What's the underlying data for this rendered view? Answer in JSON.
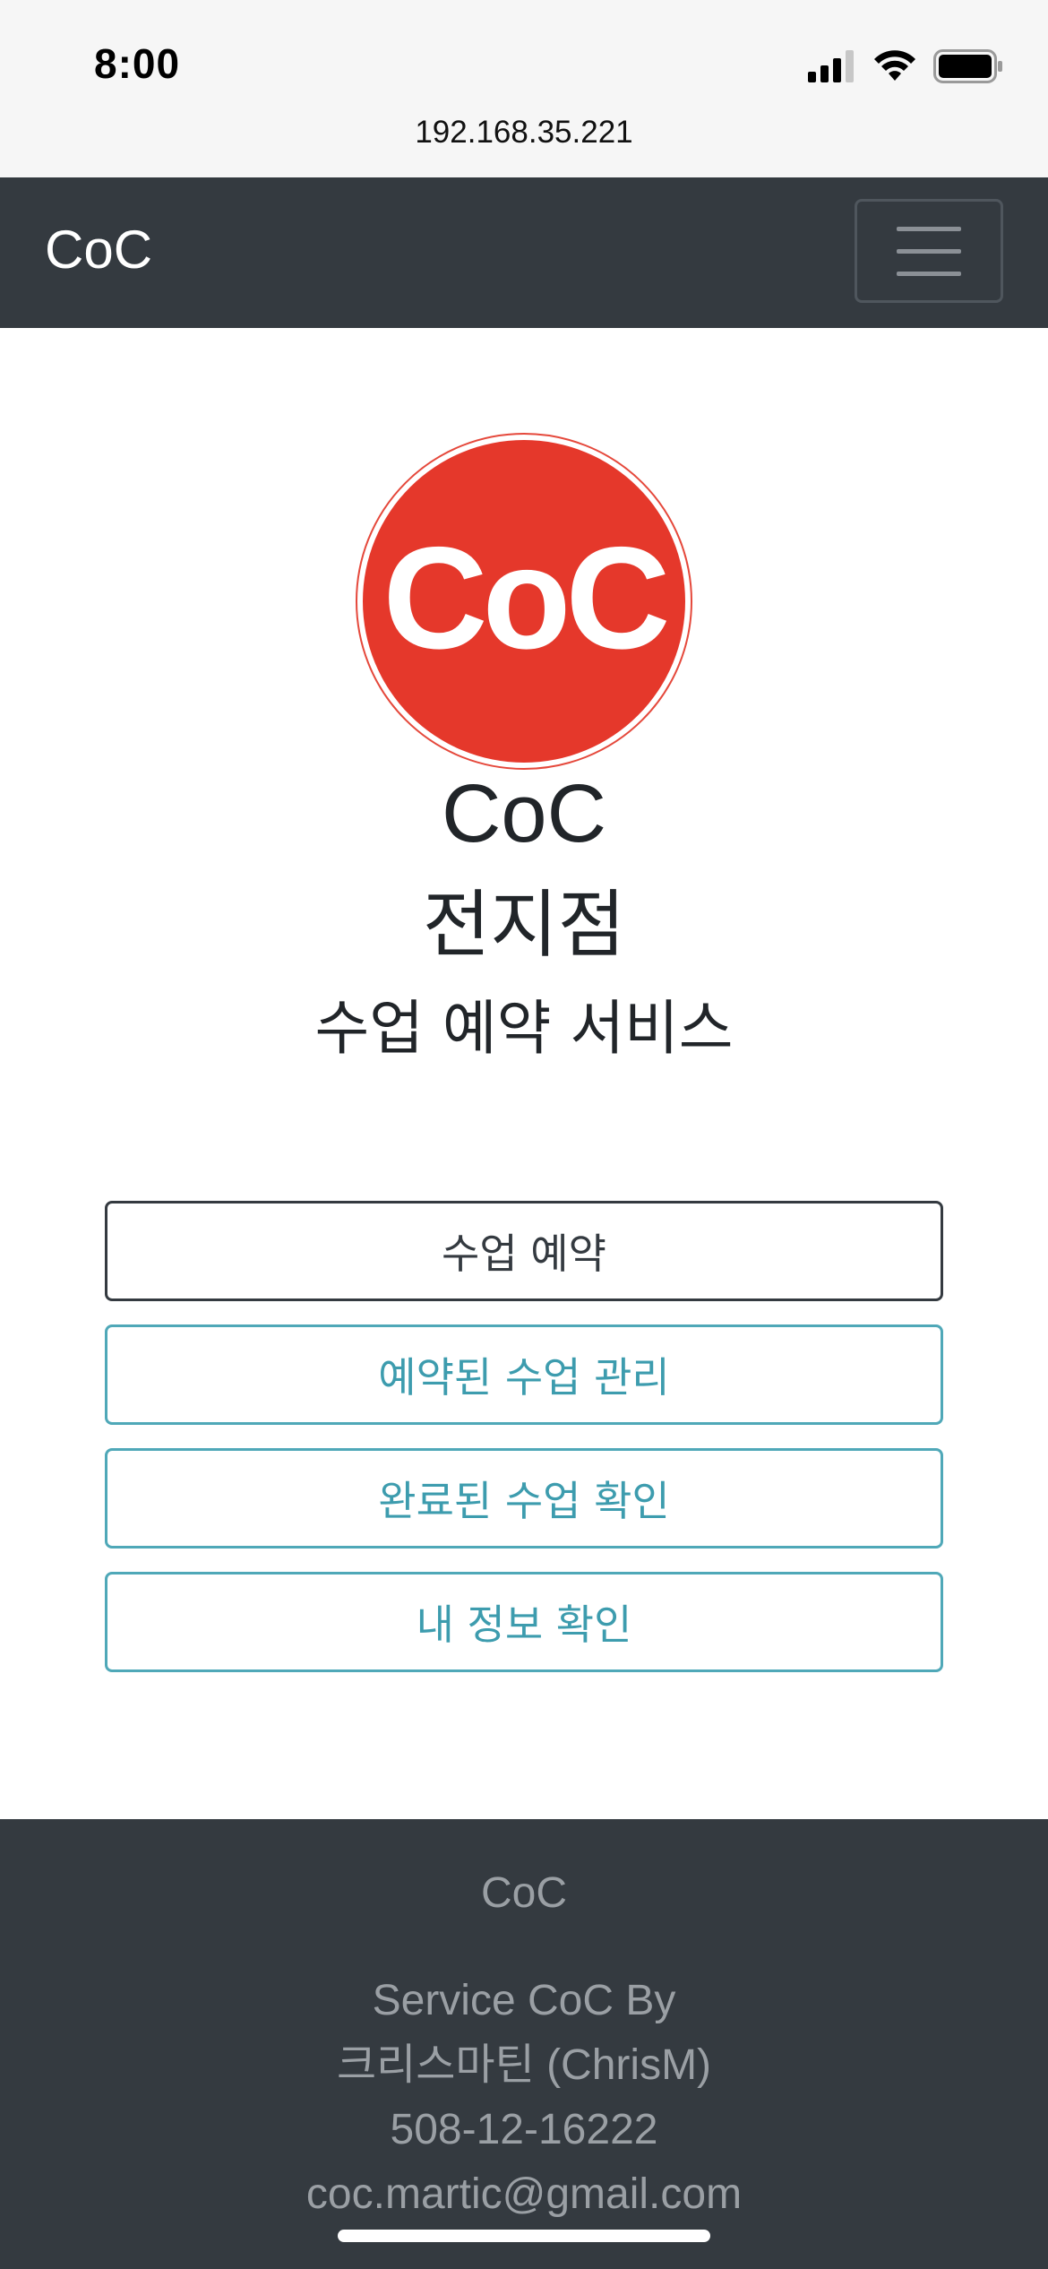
{
  "status_bar": {
    "time": "8:00",
    "url": "192.168.35.221"
  },
  "navbar": {
    "brand": "CoC",
    "menu_icon": "hamburger-menu-icon"
  },
  "hero": {
    "logo_text": "CoC",
    "title": "CoC",
    "branch": "전지점",
    "service": "수업 예약 서비스"
  },
  "buttons": {
    "reserve": "수업 예약",
    "manage_reserved": "예약된 수업 관리",
    "completed": "완료된 수업 확인",
    "my_info": "내 정보 확인"
  },
  "footer": {
    "brand": "CoC",
    "service_by": "Service CoC By",
    "author": "크리스마틴 (ChrisM)",
    "phone": "508-12-16222",
    "email": "coc.martic@gmail.com"
  },
  "colors": {
    "navbar_bg": "#343a40",
    "logo_red": "#e5382b",
    "info": "#17a2b8"
  }
}
